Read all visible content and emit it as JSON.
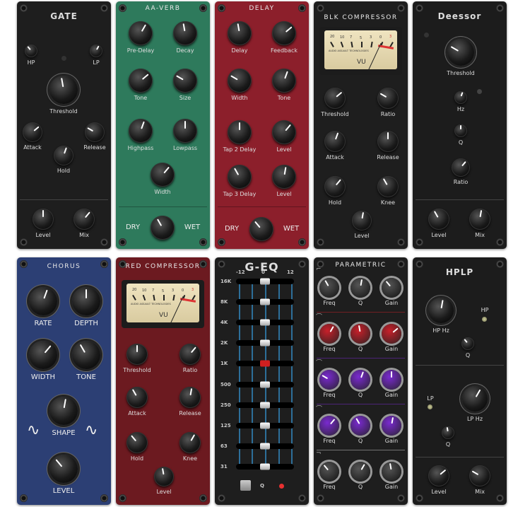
{
  "panels": [
    {
      "id": "gate",
      "title": "GATE",
      "bg": "#1e1e1e",
      "knobs": [
        {
          "label": "HP"
        },
        {
          "label": "LP"
        },
        {
          "label": "Threshold"
        },
        {
          "label": "Attack"
        },
        {
          "label": "Release"
        },
        {
          "label": "Hold"
        },
        {
          "label": "Level"
        },
        {
          "label": "Mix"
        }
      ]
    },
    {
      "id": "aa-verb",
      "title": "AA-VERB",
      "bg": "#2e7a5c",
      "knobs": [
        {
          "label": "Pre-Delay"
        },
        {
          "label": "Decay"
        },
        {
          "label": "Tone"
        },
        {
          "label": "Size"
        },
        {
          "label": "Highpass"
        },
        {
          "label": "Lowpass"
        },
        {
          "label": "Width"
        },
        {
          "label": ""
        }
      ],
      "dry": "DRY",
      "wet": "WET"
    },
    {
      "id": "delay",
      "title": "DELAY",
      "bg": "#8c1f2b",
      "knobs": [
        {
          "label": "Delay"
        },
        {
          "label": "Feedback"
        },
        {
          "label": "Width"
        },
        {
          "label": "Tone"
        },
        {
          "label": "Tap 2 Delay"
        },
        {
          "label": "Level"
        },
        {
          "label": "Tap 3 Delay"
        },
        {
          "label": "Level"
        },
        {
          "label": ""
        }
      ],
      "dry": "DRY",
      "wet": "WET"
    },
    {
      "id": "blk-compressor",
      "title": "BLK COMPRESSOR",
      "bg": "#1e1e1e",
      "knobs": [
        {
          "label": "Threshold"
        },
        {
          "label": "Ratio"
        },
        {
          "label": "Attack"
        },
        {
          "label": "Release"
        },
        {
          "label": "Hold"
        },
        {
          "label": "Knee"
        },
        {
          "label": "Level"
        }
      ],
      "vu": {
        "scale": [
          "20",
          "10",
          "7",
          "5",
          "3",
          "0",
          "3"
        ],
        "brand": "AUDIO ASSAULT TECHNOLOGIES",
        "unit": "VU"
      }
    },
    {
      "id": "deessor",
      "title": "Deessor",
      "bg": "#1c1c1c",
      "knobs": [
        {
          "label": "Threshold"
        },
        {
          "label": "Hz"
        },
        {
          "label": "Q"
        },
        {
          "label": "Ratio"
        },
        {
          "label": "Level"
        },
        {
          "label": "Mix"
        }
      ]
    },
    {
      "id": "chorus",
      "title": "CHORUS",
      "bg": "#2c3f74",
      "knobs": [
        {
          "label": "RATE"
        },
        {
          "label": "DEPTH"
        },
        {
          "label": "WIDTH"
        },
        {
          "label": "TONE"
        },
        {
          "label": "SHAPE"
        },
        {
          "label": "LEVEL"
        }
      ]
    },
    {
      "id": "red-compressor",
      "title": "RED COMPRESSOR",
      "bg": "#6c1a20",
      "knobs": [
        {
          "label": "Threshold"
        },
        {
          "label": "Ratio"
        },
        {
          "label": "Attack"
        },
        {
          "label": "Release"
        },
        {
          "label": "Hold"
        },
        {
          "label": "Knee"
        },
        {
          "label": "Level"
        }
      ],
      "vu": {
        "scale": [
          "20",
          "10",
          "7",
          "5",
          "3",
          "0",
          "3"
        ],
        "brand": "AUDIO ASSAULT TECHNOLOGIES",
        "unit": "VU"
      }
    },
    {
      "id": "g-eq",
      "title": "G-EQ",
      "bg": "#1e1e1e",
      "knobs": [],
      "scale": [
        "-12",
        "0",
        "12"
      ],
      "range": [
        -12,
        12
      ],
      "bands": [
        {
          "label": "16K",
          "gain": 0
        },
        {
          "label": "8K",
          "gain": 0
        },
        {
          "label": "4K",
          "gain": 0
        },
        {
          "label": "2K",
          "gain": 0
        },
        {
          "label": "1K",
          "gain": 0,
          "selected": true
        },
        {
          "label": "500",
          "gain": 0
        },
        {
          "label": "250",
          "gain": 0
        },
        {
          "label": "125",
          "gain": 0
        },
        {
          "label": "63",
          "gain": 0
        },
        {
          "label": "31",
          "gain": 0
        }
      ],
      "q_label": "Q",
      "selected_color": "#d02020",
      "led_color": "#e83030"
    },
    {
      "id": "parametric",
      "title": "PARAMETRIC",
      "bg": "#1e1e1e",
      "knobs": [
        {
          "label": "Freq"
        },
        {
          "label": "Q"
        },
        {
          "label": "Gain"
        },
        {
          "label": "Freq"
        },
        {
          "label": "Q"
        },
        {
          "label": "Gain"
        },
        {
          "label": "Freq"
        },
        {
          "label": "Q"
        },
        {
          "label": "Gain"
        },
        {
          "label": "Freq"
        },
        {
          "label": "Q"
        },
        {
          "label": "Gain"
        },
        {
          "label": "Freq"
        },
        {
          "label": "Q"
        },
        {
          "label": "Gain"
        }
      ],
      "band_colors": [
        "#c8c8c8",
        "#c8202a",
        "#7a2ad0",
        "#7a2ad0",
        "#c8c8c8"
      ]
    },
    {
      "id": "hplp",
      "title": "HPLP",
      "bg": "#1c1c1c",
      "knobs": [
        {
          "label": "HP Hz"
        },
        {
          "label": "Q"
        },
        {
          "label": "LP Hz"
        },
        {
          "label": "Q"
        },
        {
          "label": "Level"
        },
        {
          "label": "Mix"
        }
      ],
      "hp": "HP",
      "lp": "LP"
    }
  ]
}
